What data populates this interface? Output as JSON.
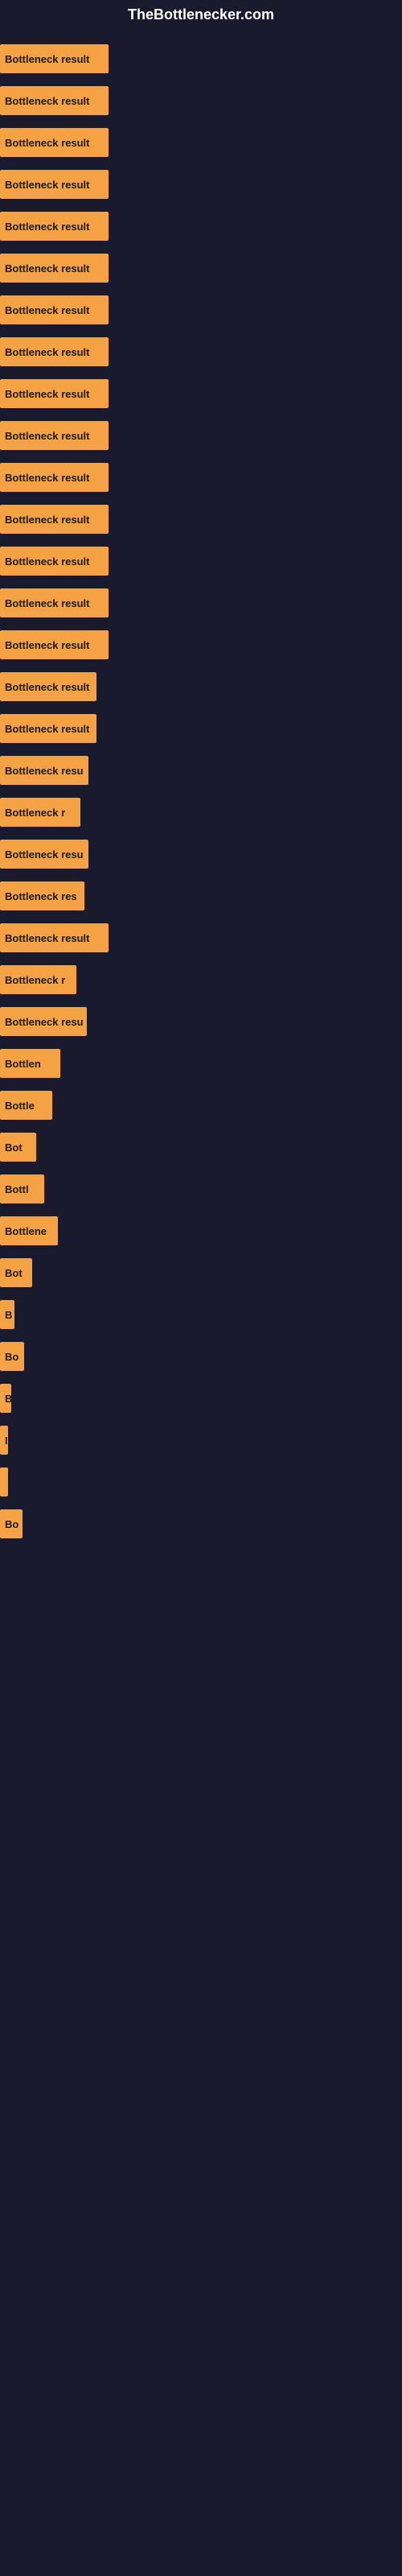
{
  "site": {
    "title": "TheBottlenecker.com"
  },
  "bars": [
    {
      "label": "Bottleneck result",
      "width": 135
    },
    {
      "label": "Bottleneck result",
      "width": 135
    },
    {
      "label": "Bottleneck result",
      "width": 135
    },
    {
      "label": "Bottleneck result",
      "width": 135
    },
    {
      "label": "Bottleneck result",
      "width": 135
    },
    {
      "label": "Bottleneck result",
      "width": 135
    },
    {
      "label": "Bottleneck result",
      "width": 135
    },
    {
      "label": "Bottleneck result",
      "width": 135
    },
    {
      "label": "Bottleneck result",
      "width": 135
    },
    {
      "label": "Bottleneck result",
      "width": 135
    },
    {
      "label": "Bottleneck result",
      "width": 135
    },
    {
      "label": "Bottleneck result",
      "width": 135
    },
    {
      "label": "Bottleneck result",
      "width": 135
    },
    {
      "label": "Bottleneck result",
      "width": 135
    },
    {
      "label": "Bottleneck result",
      "width": 135
    },
    {
      "label": "Bottleneck result",
      "width": 120
    },
    {
      "label": "Bottleneck result",
      "width": 120
    },
    {
      "label": "Bottleneck resu",
      "width": 110
    },
    {
      "label": "Bottleneck r",
      "width": 100
    },
    {
      "label": "Bottleneck resu",
      "width": 110
    },
    {
      "label": "Bottleneck res",
      "width": 105
    },
    {
      "label": "Bottleneck result",
      "width": 135
    },
    {
      "label": "Bottleneck r",
      "width": 95
    },
    {
      "label": "Bottleneck resu",
      "width": 108
    },
    {
      "label": "Bottlen",
      "width": 75
    },
    {
      "label": "Bottle",
      "width": 65
    },
    {
      "label": "Bot",
      "width": 45
    },
    {
      "label": "Bottl",
      "width": 55
    },
    {
      "label": "Bottlene",
      "width": 72
    },
    {
      "label": "Bot",
      "width": 40
    },
    {
      "label": "B",
      "width": 18
    },
    {
      "label": "Bo",
      "width": 30
    },
    {
      "label": "B",
      "width": 14
    },
    {
      "label": "I",
      "width": 8
    },
    {
      "label": "",
      "width": 5
    },
    {
      "label": "Bo",
      "width": 28
    }
  ]
}
